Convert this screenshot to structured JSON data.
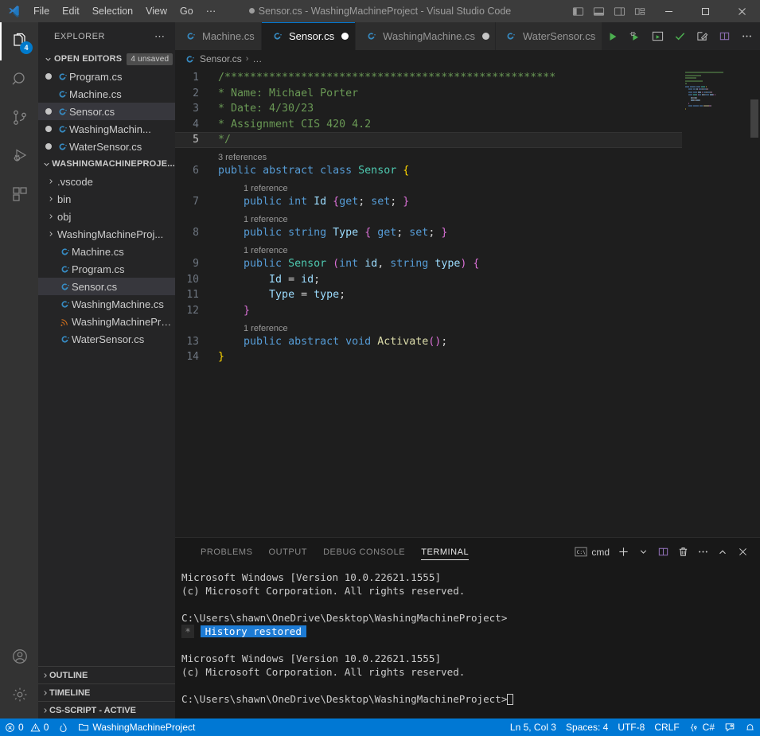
{
  "titlebar": {
    "logo_name": "vscode-logo",
    "menus": [
      "File",
      "Edit",
      "Selection",
      "View",
      "Go",
      "⋯"
    ],
    "window_title": "Sensor.cs - WashingMachineProject - Visual Studio Code",
    "dirty": true,
    "layout_buttons": [
      "toggle-primary-sidebar",
      "toggle-panel",
      "toggle-secondary-sidebar",
      "customize-layout"
    ],
    "window_buttons": [
      "minimize",
      "maximize",
      "close"
    ]
  },
  "activitybar": {
    "items": [
      {
        "name": "explorer",
        "icon": "files-icon",
        "active": true,
        "badge": "4"
      },
      {
        "name": "search",
        "icon": "search-icon",
        "active": false,
        "badge": ""
      },
      {
        "name": "source-control",
        "icon": "source-control-icon",
        "active": false,
        "badge": ""
      },
      {
        "name": "run-and-debug",
        "icon": "run-debug-icon",
        "active": false,
        "badge": ""
      },
      {
        "name": "extensions",
        "icon": "extensions-icon",
        "active": false,
        "badge": ""
      }
    ],
    "bottom": [
      {
        "name": "accounts",
        "icon": "account-icon"
      },
      {
        "name": "manage",
        "icon": "gear-icon"
      }
    ]
  },
  "sidebar": {
    "title": "EXPLORER",
    "more_actions": "⋯",
    "open_editors": {
      "label": "OPEN EDITORS",
      "badge": "4 unsaved",
      "items": [
        {
          "label": "Program.cs",
          "dirty": true,
          "selected": false
        },
        {
          "label": "Machine.cs",
          "dirty": false,
          "selected": false
        },
        {
          "label": "Sensor.cs",
          "dirty": true,
          "selected": true
        },
        {
          "label": "WashingMachin...",
          "dirty": true,
          "selected": false
        },
        {
          "label": "WaterSensor.cs",
          "dirty": true,
          "selected": false
        }
      ]
    },
    "project": {
      "label": "WASHINGMACHINEPROJE...",
      "items": [
        {
          "label": ".vscode",
          "kind": "folder",
          "selected": false
        },
        {
          "label": "bin",
          "kind": "folder",
          "selected": false
        },
        {
          "label": "obj",
          "kind": "folder",
          "selected": false
        },
        {
          "label": "WashingMachineProj...",
          "kind": "folder",
          "selected": false
        },
        {
          "label": "Machine.cs",
          "kind": "csharp",
          "selected": false
        },
        {
          "label": "Program.cs",
          "kind": "csharp",
          "selected": false
        },
        {
          "label": "Sensor.cs",
          "kind": "csharp",
          "selected": true
        },
        {
          "label": "WashingMachine.cs",
          "kind": "csharp",
          "selected": false
        },
        {
          "label": "WashingMachineProj...",
          "kind": "csproj",
          "selected": false
        },
        {
          "label": "WaterSensor.cs",
          "kind": "csharp",
          "selected": false
        }
      ]
    },
    "collapsed_sections": [
      "OUTLINE",
      "TIMELINE",
      "CS-SCRIPT - ACTIVE"
    ]
  },
  "tabs": [
    {
      "label": "Machine.cs",
      "active": false,
      "dirty": false
    },
    {
      "label": "Sensor.cs",
      "active": true,
      "dirty": true
    },
    {
      "label": "WashingMachine.cs",
      "active": false,
      "dirty": true
    },
    {
      "label": "WaterSensor.cs",
      "active": false,
      "dirty": false
    }
  ],
  "editor_actions": [
    {
      "name": "run-code-button",
      "icon": "play-icon"
    },
    {
      "name": "run-and-debug-button",
      "icon": "debug-play-icon"
    },
    {
      "name": "run-in-terminal-button",
      "icon": "run-terminal-icon"
    },
    {
      "name": "check-button",
      "icon": "check-icon"
    },
    {
      "name": "edit-mode-button",
      "icon": "pencil-square-icon"
    },
    {
      "name": "split-editor-button",
      "icon": "split-editor-icon"
    },
    {
      "name": "more-actions-button",
      "icon": "ellipsis-icon"
    }
  ],
  "breadcrumb": {
    "file": "Sensor.cs",
    "separator": "›",
    "trail": "…"
  },
  "code": {
    "language": "csharp",
    "current_line": 5,
    "lines": [
      {
        "n": 1,
        "ref": "",
        "tokens": [
          {
            "t": "/****************************************************",
            "c": "c-comment"
          }
        ]
      },
      {
        "n": 2,
        "ref": "",
        "tokens": [
          {
            "t": "* Name: Michael Porter",
            "c": "c-comment"
          }
        ]
      },
      {
        "n": 3,
        "ref": "",
        "tokens": [
          {
            "t": "* Date: 4/30/23",
            "c": "c-comment"
          }
        ]
      },
      {
        "n": 4,
        "ref": "",
        "tokens": [
          {
            "t": "* Assignment CIS 420 4.2",
            "c": "c-comment"
          }
        ]
      },
      {
        "n": 5,
        "ref": "",
        "tokens": [
          {
            "t": "*/",
            "c": "c-comment"
          }
        ]
      },
      {
        "n": 6,
        "ref": "3 references",
        "tokens": [
          {
            "t": "public",
            "c": "c-key"
          },
          {
            "t": " ",
            "c": "c-white"
          },
          {
            "t": "abstract",
            "c": "c-key"
          },
          {
            "t": " ",
            "c": "c-white"
          },
          {
            "t": "class",
            "c": "c-key"
          },
          {
            "t": " ",
            "c": "c-white"
          },
          {
            "t": "Sensor",
            "c": "c-type"
          },
          {
            "t": " ",
            "c": "c-white"
          },
          {
            "t": "{",
            "c": "c-brace-y"
          }
        ]
      },
      {
        "n": 7,
        "ref": "1 reference",
        "tokens": [
          {
            "t": "    ",
            "c": "c-white"
          },
          {
            "t": "public",
            "c": "c-key"
          },
          {
            "t": " ",
            "c": "c-white"
          },
          {
            "t": "int",
            "c": "c-key"
          },
          {
            "t": " ",
            "c": "c-white"
          },
          {
            "t": "Id",
            "c": "c-ident"
          },
          {
            "t": " ",
            "c": "c-white"
          },
          {
            "t": "{",
            "c": "c-brace-p"
          },
          {
            "t": "get",
            "c": "c-key"
          },
          {
            "t": "; ",
            "c": "c-white"
          },
          {
            "t": "set",
            "c": "c-key"
          },
          {
            "t": "; ",
            "c": "c-white"
          },
          {
            "t": "}",
            "c": "c-brace-p"
          }
        ]
      },
      {
        "n": 8,
        "ref": "1 reference",
        "tokens": [
          {
            "t": "    ",
            "c": "c-white"
          },
          {
            "t": "public",
            "c": "c-key"
          },
          {
            "t": " ",
            "c": "c-white"
          },
          {
            "t": "string",
            "c": "c-key"
          },
          {
            "t": " ",
            "c": "c-white"
          },
          {
            "t": "Type",
            "c": "c-ident"
          },
          {
            "t": " ",
            "c": "c-white"
          },
          {
            "t": "{",
            "c": "c-brace-p"
          },
          {
            "t": " ",
            "c": "c-white"
          },
          {
            "t": "get",
            "c": "c-key"
          },
          {
            "t": "; ",
            "c": "c-white"
          },
          {
            "t": "set",
            "c": "c-key"
          },
          {
            "t": "; ",
            "c": "c-white"
          },
          {
            "t": "}",
            "c": "c-brace-p"
          }
        ]
      },
      {
        "n": 9,
        "ref": "1 reference",
        "tokens": [
          {
            "t": "    ",
            "c": "c-white"
          },
          {
            "t": "public",
            "c": "c-key"
          },
          {
            "t": " ",
            "c": "c-white"
          },
          {
            "t": "Sensor",
            "c": "c-type"
          },
          {
            "t": " ",
            "c": "c-white"
          },
          {
            "t": "(",
            "c": "c-brace-p"
          },
          {
            "t": "int",
            "c": "c-key"
          },
          {
            "t": " ",
            "c": "c-white"
          },
          {
            "t": "id",
            "c": "c-ident"
          },
          {
            "t": ", ",
            "c": "c-white"
          },
          {
            "t": "string",
            "c": "c-key"
          },
          {
            "t": " ",
            "c": "c-white"
          },
          {
            "t": "type",
            "c": "c-ident"
          },
          {
            "t": ")",
            "c": "c-brace-p"
          },
          {
            "t": " ",
            "c": "c-white"
          },
          {
            "t": "{",
            "c": "c-brace-p"
          }
        ]
      },
      {
        "n": 10,
        "ref": "",
        "tokens": [
          {
            "t": "        ",
            "c": "c-white"
          },
          {
            "t": "Id",
            "c": "c-ident"
          },
          {
            "t": " = ",
            "c": "c-white"
          },
          {
            "t": "id",
            "c": "c-ident"
          },
          {
            "t": ";",
            "c": "c-white"
          }
        ]
      },
      {
        "n": 11,
        "ref": "",
        "tokens": [
          {
            "t": "        ",
            "c": "c-white"
          },
          {
            "t": "Type",
            "c": "c-ident"
          },
          {
            "t": " = ",
            "c": "c-white"
          },
          {
            "t": "type",
            "c": "c-ident"
          },
          {
            "t": ";",
            "c": "c-white"
          }
        ]
      },
      {
        "n": 12,
        "ref": "",
        "tokens": [
          {
            "t": "    ",
            "c": "c-white"
          },
          {
            "t": "}",
            "c": "c-brace-p"
          }
        ]
      },
      {
        "n": 13,
        "ref": "1 reference",
        "tokens": [
          {
            "t": "    ",
            "c": "c-white"
          },
          {
            "t": "public",
            "c": "c-key"
          },
          {
            "t": " ",
            "c": "c-white"
          },
          {
            "t": "abstract",
            "c": "c-key"
          },
          {
            "t": " ",
            "c": "c-white"
          },
          {
            "t": "void",
            "c": "c-key"
          },
          {
            "t": " ",
            "c": "c-white"
          },
          {
            "t": "Activate",
            "c": "c-func"
          },
          {
            "t": "(",
            "c": "c-brace-p"
          },
          {
            "t": ")",
            "c": "c-brace-p"
          },
          {
            "t": ";",
            "c": "c-white"
          }
        ]
      },
      {
        "n": 14,
        "ref": "",
        "tokens": [
          {
            "t": "}",
            "c": "c-brace-y"
          }
        ]
      }
    ]
  },
  "panel": {
    "tabs": [
      {
        "label": "PROBLEMS",
        "active": false
      },
      {
        "label": "OUTPUT",
        "active": false
      },
      {
        "label": "DEBUG CONSOLE",
        "active": false
      },
      {
        "label": "TERMINAL",
        "active": true
      }
    ],
    "shell": "cmd",
    "actions": [
      {
        "name": "new-terminal-button",
        "icon": "plus-icon"
      },
      {
        "name": "terminal-profile-dropdown",
        "icon": "chevron-down-icon"
      },
      {
        "name": "split-terminal-button",
        "icon": "split-icon"
      },
      {
        "name": "kill-terminal-button",
        "icon": "trash-icon"
      },
      {
        "name": "panel-more-actions",
        "icon": "ellipsis-icon"
      },
      {
        "name": "maximize-panel-button",
        "icon": "chevron-up-icon"
      },
      {
        "name": "close-panel-button",
        "icon": "close-icon"
      }
    ],
    "terminal_lines": [
      {
        "text": "Microsoft Windows [Version 10.0.22621.1555]",
        "style": "plain"
      },
      {
        "text": "(c) Microsoft Corporation. All rights reserved.",
        "style": "plain"
      },
      {
        "text": "",
        "style": "plain"
      },
      {
        "text": "C:\\Users\\shawn\\OneDrive\\Desktop\\WashingMachineProject>",
        "style": "plain"
      },
      {
        "text": "History restored",
        "style": "history"
      },
      {
        "text": "",
        "style": "plain"
      },
      {
        "text": "Microsoft Windows [Version 10.0.22621.1555]",
        "style": "plain"
      },
      {
        "text": "(c) Microsoft Corporation. All rights reserved.",
        "style": "plain"
      },
      {
        "text": "",
        "style": "plain"
      },
      {
        "text": "C:\\Users\\shawn\\OneDrive\\Desktop\\WashingMachineProject>",
        "style": "cursor"
      }
    ]
  },
  "statusbar": {
    "errors": "0",
    "warnings": "0",
    "radio_tower": "",
    "folder": "WashingMachineProject",
    "position": "Ln 5, Col 3",
    "indent": "Spaces: 4",
    "encoding": "UTF-8",
    "eol": "CRLF",
    "language": "C#",
    "feedback_icon": "feedback-icon",
    "bell_icon": "bell-icon"
  },
  "colors": {
    "accent": "#0078d4",
    "titlebar_bg": "#3c3c3c",
    "sidebar_bg": "#252526",
    "editor_bg": "#1e1e1e",
    "panel_bg": "#181818",
    "csharp_icon": "#368ac1",
    "history_highlight": "#1d7bd4"
  }
}
